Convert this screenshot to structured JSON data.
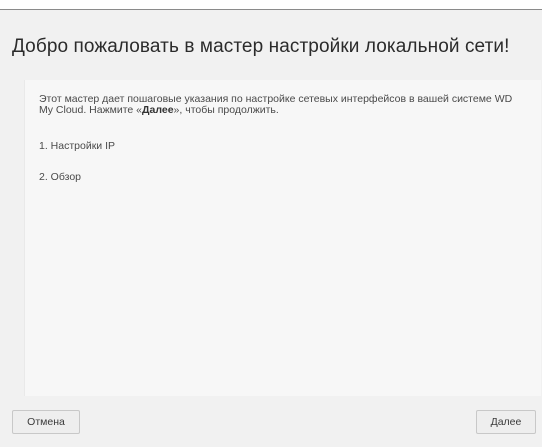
{
  "dialog": {
    "title": "Добро пожаловать в мастер настройки локальной сети!",
    "intro_prefix": "Этот мастер дает пошаговые указания по настройке сетевых интерфейсов в вашей системе WD My Cloud. Нажмите «",
    "intro_bold": "Далее",
    "intro_suffix": "», чтобы продолжить.",
    "steps": [
      "1. Настройки IP",
      "2. Обзор"
    ]
  },
  "buttons": {
    "cancel_label": "Отмена",
    "next_label": "Далее"
  }
}
